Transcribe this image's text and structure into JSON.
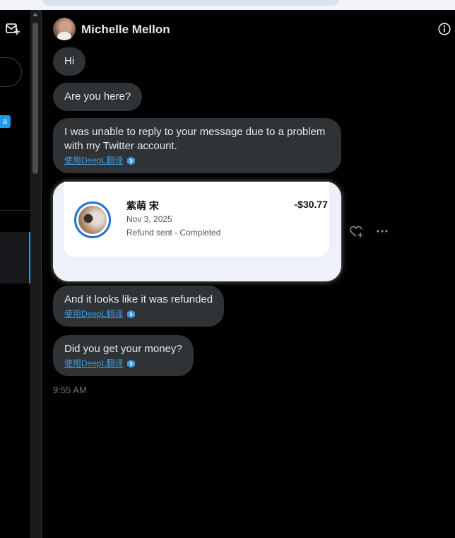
{
  "header": {
    "contact_name": "Michelle Mellon"
  },
  "sidebar": {
    "badge_text": "a"
  },
  "messages": [
    {
      "text": "Hi"
    },
    {
      "text": "Are you here?"
    },
    {
      "text": "I was unable to reply to your message due to a problem with my Twitter account.",
      "translate_link": "使用DeepL翻译"
    },
    {
      "text": "And it looks like it was refunded",
      "translate_link": "使用DeepL翻译"
    },
    {
      "text": "Did you get your money?",
      "translate_link": "使用DeepL翻译"
    }
  ],
  "payment_card": {
    "name": "紫萌 宋",
    "date": "Nov 3, 2025",
    "status": "Refund sent - Completed",
    "amount": "-$30.77"
  },
  "timestamp": "9:55 AM",
  "colors": {
    "accent": "#1d9bf0",
    "bubble_bg": "#2f3336",
    "translate_link": "#3f9bd8"
  },
  "icons": {
    "compose": "compose-message-icon",
    "info": "info-icon",
    "react": "heart-plus-icon",
    "more": "more-dots-icon",
    "deepl": "deepl-icon"
  }
}
